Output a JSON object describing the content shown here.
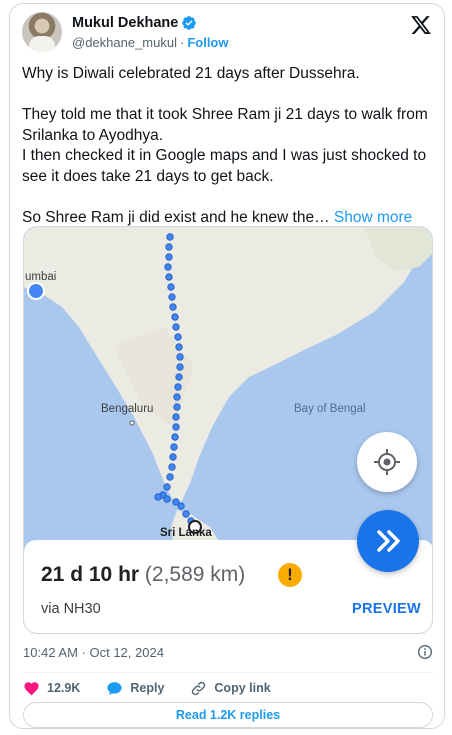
{
  "author": {
    "name": "Mukul Dekhane",
    "handle": "@dekhane_mukul",
    "separator": "·",
    "follow_label": "Follow"
  },
  "tweet": {
    "lines": [
      "Why is Diwali celebrated 21 days after Dussehra.",
      "They told me that it took Shree Ram ji 21 days to walk from Srilanka to Ayodhya.",
      "I then checked it in Google maps and I was just shocked to see it does take 21 days to get back.",
      "So Shree Ram ji did exist and he knew the…"
    ],
    "show_more": "Show more"
  },
  "map": {
    "labels": {
      "city_mumbai": "umbai",
      "city_bengaluru": "Bengaluru",
      "country_srilanka": "Sri Lanka",
      "sea": "Bay of Bengal"
    },
    "eta_days": "21 d",
    "eta_hours": "10 hr",
    "distance": "(2,589 km)",
    "warning": "!",
    "route": "via NH30",
    "preview_label": "PREVIEW"
  },
  "meta": {
    "timestamp": "10:42 AM · Oct 12, 2024"
  },
  "actions": {
    "likes": "12.9K",
    "reply_label": "Reply",
    "copy_link_label": "Copy link",
    "read_replies": "Read 1.2K replies"
  },
  "colors": {
    "accent": "#1d9bf0",
    "maps_blue": "#1a73e8",
    "like_red": "#f91880",
    "warning": "#f9ab00"
  }
}
